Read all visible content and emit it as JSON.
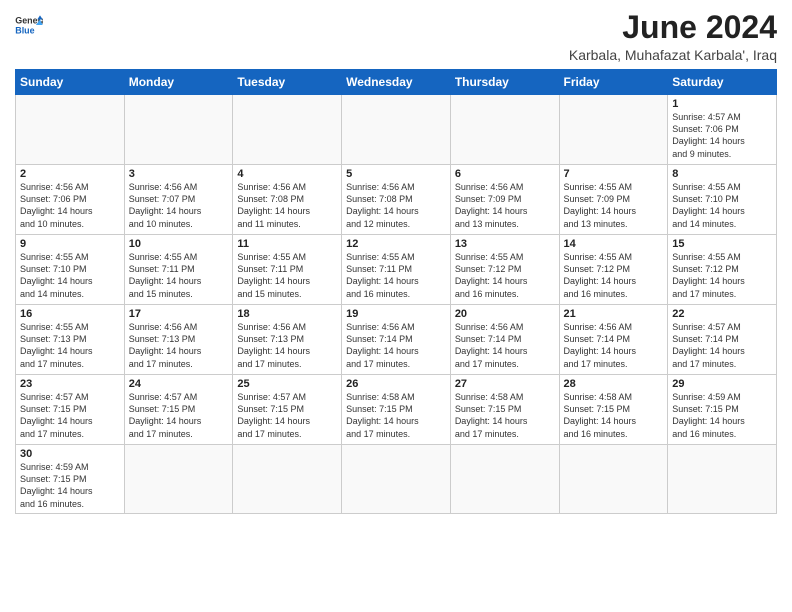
{
  "header": {
    "logo_general": "General",
    "logo_blue": "Blue",
    "title": "June 2024",
    "subtitle": "Karbala, Muhafazat Karbala', Iraq"
  },
  "weekdays": [
    "Sunday",
    "Monday",
    "Tuesday",
    "Wednesday",
    "Thursday",
    "Friday",
    "Saturday"
  ],
  "weeks": [
    [
      {
        "date": "",
        "info": ""
      },
      {
        "date": "",
        "info": ""
      },
      {
        "date": "",
        "info": ""
      },
      {
        "date": "",
        "info": ""
      },
      {
        "date": "",
        "info": ""
      },
      {
        "date": "",
        "info": ""
      },
      {
        "date": "1",
        "info": "Sunrise: 4:57 AM\nSunset: 7:06 PM\nDaylight: 14 hours\nand 9 minutes."
      }
    ],
    [
      {
        "date": "2",
        "info": "Sunrise: 4:56 AM\nSunset: 7:06 PM\nDaylight: 14 hours\nand 10 minutes."
      },
      {
        "date": "3",
        "info": "Sunrise: 4:56 AM\nSunset: 7:07 PM\nDaylight: 14 hours\nand 10 minutes."
      },
      {
        "date": "4",
        "info": "Sunrise: 4:56 AM\nSunset: 7:08 PM\nDaylight: 14 hours\nand 11 minutes."
      },
      {
        "date": "5",
        "info": "Sunrise: 4:56 AM\nSunset: 7:08 PM\nDaylight: 14 hours\nand 12 minutes."
      },
      {
        "date": "6",
        "info": "Sunrise: 4:56 AM\nSunset: 7:09 PM\nDaylight: 14 hours\nand 13 minutes."
      },
      {
        "date": "7",
        "info": "Sunrise: 4:55 AM\nSunset: 7:09 PM\nDaylight: 14 hours\nand 13 minutes."
      },
      {
        "date": "8",
        "info": "Sunrise: 4:55 AM\nSunset: 7:10 PM\nDaylight: 14 hours\nand 14 minutes."
      }
    ],
    [
      {
        "date": "9",
        "info": "Sunrise: 4:55 AM\nSunset: 7:10 PM\nDaylight: 14 hours\nand 14 minutes."
      },
      {
        "date": "10",
        "info": "Sunrise: 4:55 AM\nSunset: 7:11 PM\nDaylight: 14 hours\nand 15 minutes."
      },
      {
        "date": "11",
        "info": "Sunrise: 4:55 AM\nSunset: 7:11 PM\nDaylight: 14 hours\nand 15 minutes."
      },
      {
        "date": "12",
        "info": "Sunrise: 4:55 AM\nSunset: 7:11 PM\nDaylight: 14 hours\nand 16 minutes."
      },
      {
        "date": "13",
        "info": "Sunrise: 4:55 AM\nSunset: 7:12 PM\nDaylight: 14 hours\nand 16 minutes."
      },
      {
        "date": "14",
        "info": "Sunrise: 4:55 AM\nSunset: 7:12 PM\nDaylight: 14 hours\nand 16 minutes."
      },
      {
        "date": "15",
        "info": "Sunrise: 4:55 AM\nSunset: 7:12 PM\nDaylight: 14 hours\nand 17 minutes."
      }
    ],
    [
      {
        "date": "16",
        "info": "Sunrise: 4:55 AM\nSunset: 7:13 PM\nDaylight: 14 hours\nand 17 minutes."
      },
      {
        "date": "17",
        "info": "Sunrise: 4:56 AM\nSunset: 7:13 PM\nDaylight: 14 hours\nand 17 minutes."
      },
      {
        "date": "18",
        "info": "Sunrise: 4:56 AM\nSunset: 7:13 PM\nDaylight: 14 hours\nand 17 minutes."
      },
      {
        "date": "19",
        "info": "Sunrise: 4:56 AM\nSunset: 7:14 PM\nDaylight: 14 hours\nand 17 minutes."
      },
      {
        "date": "20",
        "info": "Sunrise: 4:56 AM\nSunset: 7:14 PM\nDaylight: 14 hours\nand 17 minutes."
      },
      {
        "date": "21",
        "info": "Sunrise: 4:56 AM\nSunset: 7:14 PM\nDaylight: 14 hours\nand 17 minutes."
      },
      {
        "date": "22",
        "info": "Sunrise: 4:57 AM\nSunset: 7:14 PM\nDaylight: 14 hours\nand 17 minutes."
      }
    ],
    [
      {
        "date": "23",
        "info": "Sunrise: 4:57 AM\nSunset: 7:15 PM\nDaylight: 14 hours\nand 17 minutes."
      },
      {
        "date": "24",
        "info": "Sunrise: 4:57 AM\nSunset: 7:15 PM\nDaylight: 14 hours\nand 17 minutes."
      },
      {
        "date": "25",
        "info": "Sunrise: 4:57 AM\nSunset: 7:15 PM\nDaylight: 14 hours\nand 17 minutes."
      },
      {
        "date": "26",
        "info": "Sunrise: 4:58 AM\nSunset: 7:15 PM\nDaylight: 14 hours\nand 17 minutes."
      },
      {
        "date": "27",
        "info": "Sunrise: 4:58 AM\nSunset: 7:15 PM\nDaylight: 14 hours\nand 17 minutes."
      },
      {
        "date": "28",
        "info": "Sunrise: 4:58 AM\nSunset: 7:15 PM\nDaylight: 14 hours\nand 16 minutes."
      },
      {
        "date": "29",
        "info": "Sunrise: 4:59 AM\nSunset: 7:15 PM\nDaylight: 14 hours\nand 16 minutes."
      }
    ],
    [
      {
        "date": "30",
        "info": "Sunrise: 4:59 AM\nSunset: 7:15 PM\nDaylight: 14 hours\nand 16 minutes."
      },
      {
        "date": "",
        "info": ""
      },
      {
        "date": "",
        "info": ""
      },
      {
        "date": "",
        "info": ""
      },
      {
        "date": "",
        "info": ""
      },
      {
        "date": "",
        "info": ""
      },
      {
        "date": "",
        "info": ""
      }
    ]
  ]
}
